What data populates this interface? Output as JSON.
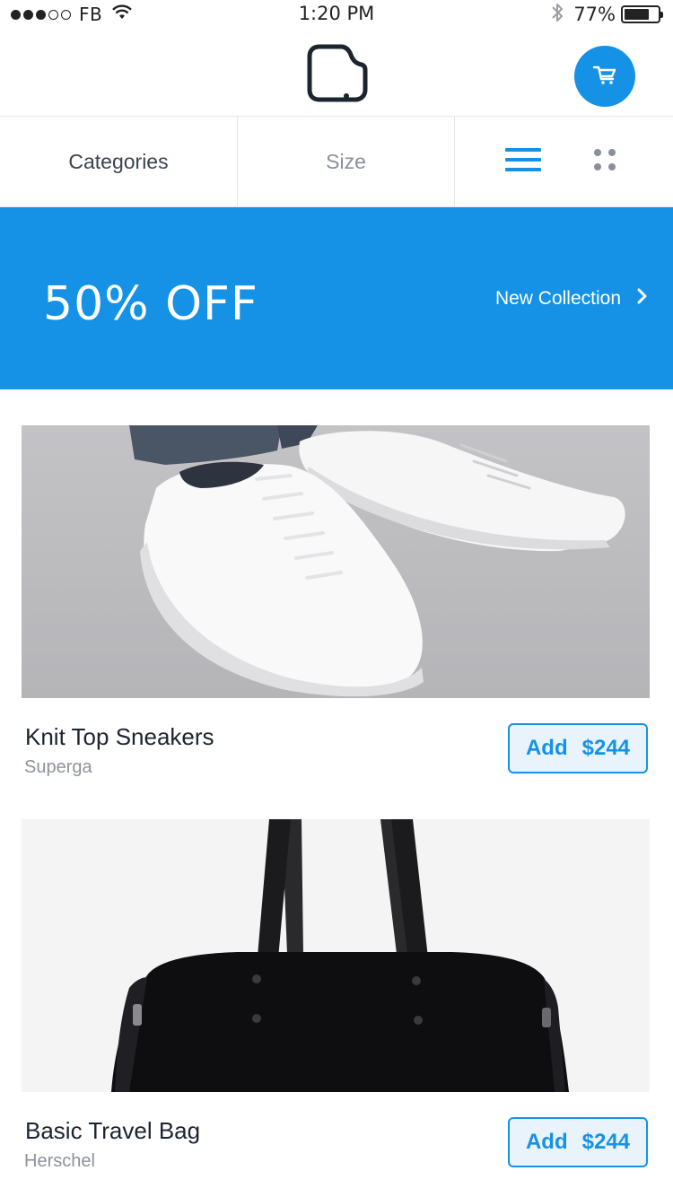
{
  "status_bar": {
    "signal_dots_filled": 3,
    "signal_dots_total": 5,
    "carrier": "FB",
    "time": "1:20 PM",
    "battery_percent_label": "77%",
    "battery_level": 0.77,
    "icons": [
      "wifi-icon",
      "bluetooth-icon",
      "battery-icon"
    ]
  },
  "nav": {
    "logo_icon": "app-logo-icon",
    "cart_icon": "cart-icon"
  },
  "filters": {
    "categories_label": "Categories",
    "size_label": "Size",
    "list_view_icon": "list-view-icon",
    "grid_view_icon": "grid-view-icon"
  },
  "promo": {
    "title": "50% OFF",
    "link_label": "New Collection",
    "chevron_icon": "chevron-right-icon"
  },
  "products": [
    {
      "name": "Knit Top Sneakers",
      "brand": "Superga",
      "add_label": "Add",
      "price": "$244"
    },
    {
      "name": "Basic Travel Bag",
      "brand": "Herschel",
      "add_label": "Add",
      "price": "$244"
    }
  ],
  "colors": {
    "accent": "#1592e6",
    "button_bg": "#e8f3fc",
    "text_primary": "#1c2430",
    "text_secondary": "#8d929a"
  }
}
